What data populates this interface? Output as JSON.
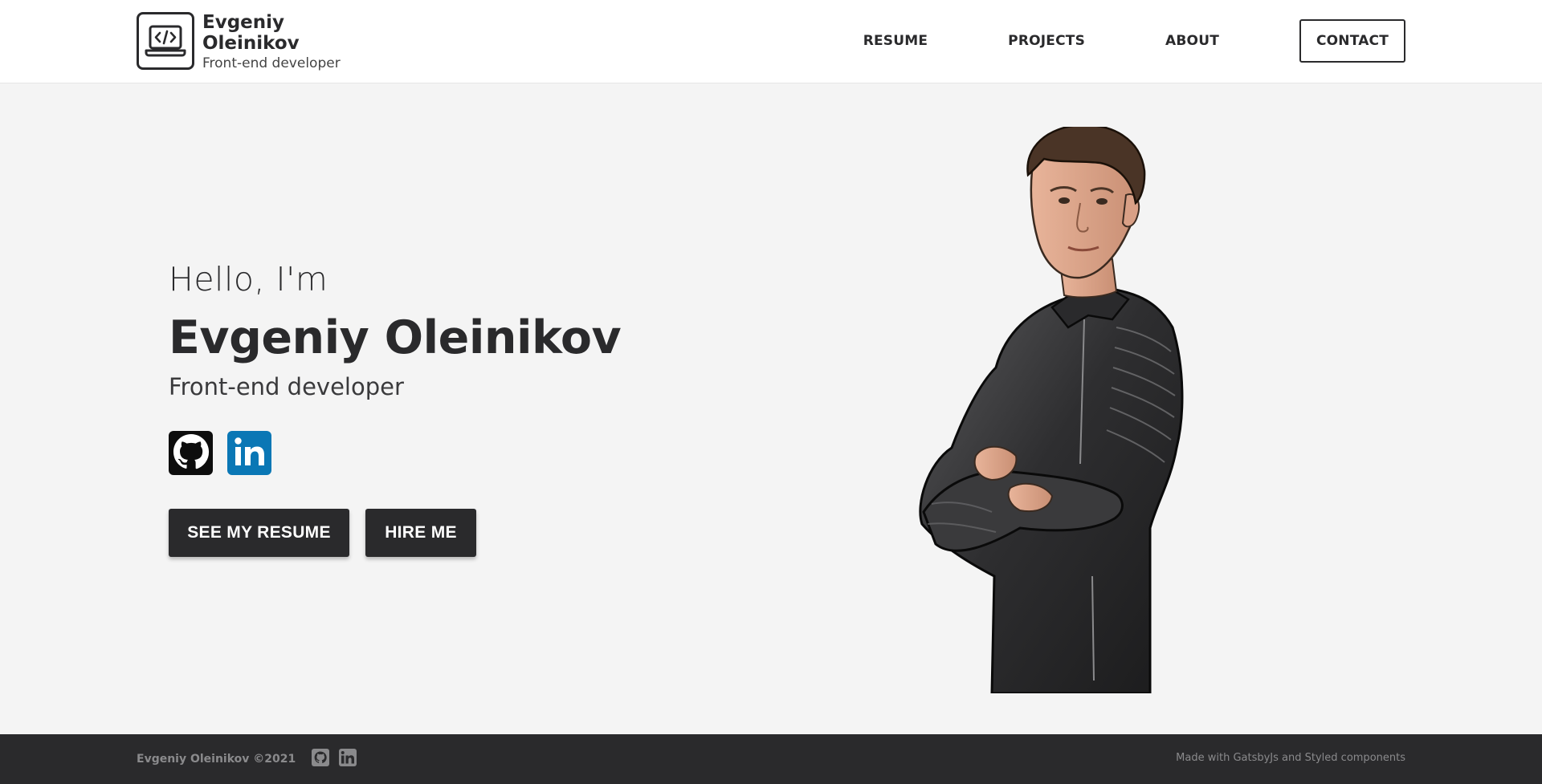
{
  "header": {
    "logo_name": "Evgeniy Oleinikov",
    "logo_subtitle": "Front-end developer",
    "logo_icon": "laptop-code-icon",
    "nav": {
      "resume": "RESUME",
      "projects": "PROJECTS",
      "about": "ABOUT",
      "contact": "CONTACT"
    }
  },
  "hero": {
    "greeting": "Hello, I'm",
    "name": "Evgeniy Oleinikov",
    "role": "Front-end developer",
    "socials": [
      {
        "icon": "github-icon",
        "color": "#0d0d0d"
      },
      {
        "icon": "linkedin-icon",
        "color": "#0a77b5"
      }
    ],
    "buttons": {
      "resume": "SEE MY RESUME",
      "hire": "HIRE ME"
    }
  },
  "footer": {
    "copyright": "Evgeniy Oleinikov ©2021",
    "made_with": "Made with GatsbyJs and Styled components"
  },
  "colors": {
    "dark": "#2a2a2c",
    "background": "#f4f4f4",
    "header_bg": "#ffffff",
    "linkedin": "#0a77b5",
    "footer_text": "#8a8a8c"
  }
}
